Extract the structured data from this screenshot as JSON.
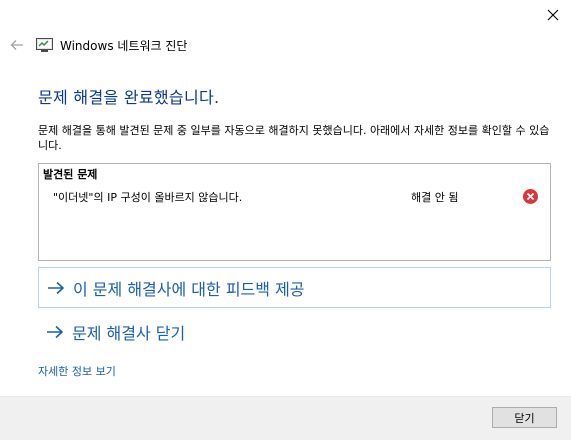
{
  "window": {
    "title": "Windows 네트워크 진단"
  },
  "icons": {
    "close": "close-icon",
    "back": "back-arrow-icon",
    "app": "network-diagnostics-icon",
    "error": "error-icon",
    "link_arrow": "arrow-right-icon"
  },
  "colors": {
    "heading": "#0a3a8c",
    "link": "#1a5fb4",
    "error": "#d9363e",
    "link_box_border": "#b7d4ea"
  },
  "main": {
    "heading": "문제 해결을 완료했습니다.",
    "description": "문제 해결을 통해 발견된 문제 중 일부를 자동으로 해결하지 못했습니다. 아래에서 자세한 정보를 확인할 수 있습니다."
  },
  "problems": {
    "header": "발견된 문제",
    "items": [
      {
        "name": "\"이더넷\"의 IP 구성이 올바르지 않습니다.",
        "status": "해결 안 됨"
      }
    ]
  },
  "links": {
    "feedback": "이 문제 해결사에 대한 피드백 제공",
    "close_troubleshooter": "문제 해결사 닫기",
    "details": "자세한 정보 보기"
  },
  "footer": {
    "close_button": "닫기"
  }
}
